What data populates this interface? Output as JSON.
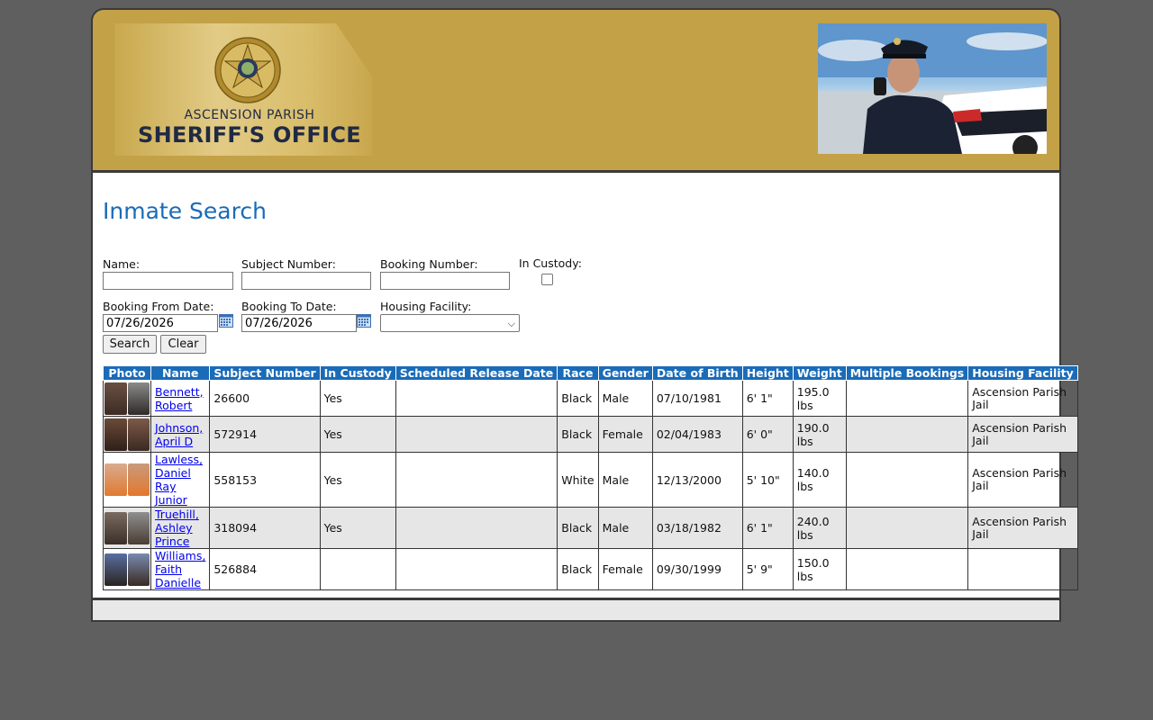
{
  "header": {
    "org_line1": "ASCENSION PARISH",
    "org_line2": "SHERIFF'S OFFICE",
    "seal_text_top": "200th ANNIVERSARY",
    "seal_text_bottom": "LOUISIANA",
    "seal_years_left": "1812",
    "seal_years_right": "2012",
    "brand_color": "#c3a146"
  },
  "page": {
    "title": "Inmate Search"
  },
  "form": {
    "name_label": "Name:",
    "name_value": "",
    "subject_label": "Subject Number:",
    "subject_value": "",
    "booking_label": "Booking Number:",
    "booking_value": "",
    "custody_label": "In Custody:",
    "custody_checked": false,
    "from_label": "Booking From Date:",
    "from_value": "07/26/2026",
    "to_label": "Booking To Date:",
    "to_value": "07/26/2026",
    "facility_label": "Housing Facility:",
    "facility_value": "",
    "search_label": "Search",
    "clear_label": "Clear"
  },
  "table": {
    "header_color": "#1a6bb8",
    "columns": [
      "Photo",
      "Name",
      "Subject Number",
      "In Custody",
      "Scheduled Release Date",
      "Race",
      "Gender",
      "Date of Birth",
      "Height",
      "Weight",
      "Multiple Bookings",
      "Housing Facility"
    ],
    "rows": [
      {
        "name": "Bennett, Robert",
        "subject": "26600",
        "custody": "Yes",
        "release": "",
        "race": "Black",
        "gender": "Male",
        "dob": "07/10/1981",
        "height": "6' 1\"",
        "weight": "195.0 lbs",
        "multiple": "",
        "facility": "Ascension Parish Jail"
      },
      {
        "name": "Johnson, April D",
        "subject": "572914",
        "custody": "Yes",
        "release": "",
        "race": "Black",
        "gender": "Female",
        "dob": "02/04/1983",
        "height": "6' 0\"",
        "weight": "190.0 lbs",
        "multiple": "",
        "facility": "Ascension Parish Jail"
      },
      {
        "name": "Lawless, Daniel Ray Junior",
        "subject": "558153",
        "custody": "Yes",
        "release": "",
        "race": "White",
        "gender": "Male",
        "dob": "12/13/2000",
        "height": "5' 10\"",
        "weight": "140.0 lbs",
        "multiple": "",
        "facility": "Ascension Parish Jail"
      },
      {
        "name": "Truehill, Ashley Prince",
        "subject": "318094",
        "custody": "Yes",
        "release": "",
        "race": "Black",
        "gender": "Male",
        "dob": "03/18/1982",
        "height": "6' 1\"",
        "weight": "240.0 lbs",
        "multiple": "",
        "facility": "Ascension Parish Jail"
      },
      {
        "name": "Williams, Faith Danielle",
        "subject": "526884",
        "custody": "",
        "release": "",
        "race": "Black",
        "gender": "Female",
        "dob": "09/30/1999",
        "height": "5' 9\"",
        "weight": "150.0 lbs",
        "multiple": "",
        "facility": ""
      }
    ]
  }
}
